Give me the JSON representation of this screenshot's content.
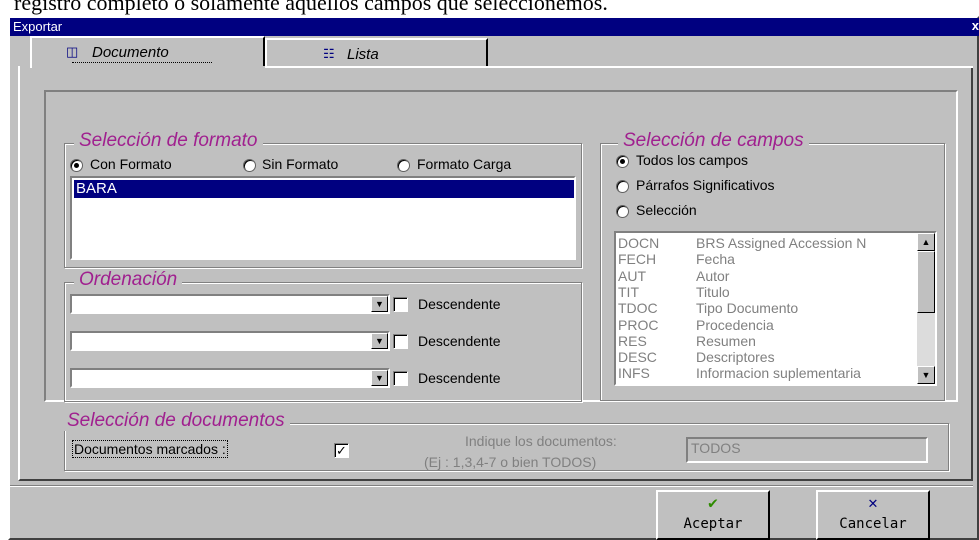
{
  "page_text": "registro completo o solamente aquellos campos que seleccionemos.",
  "window": {
    "title": "Exportar",
    "close_glyph": "x"
  },
  "tabs": [
    {
      "label": "Documento",
      "icon": "document-icon"
    },
    {
      "label": "Lista",
      "icon": "list-icon"
    }
  ],
  "formato": {
    "legend": "Selección de formato",
    "options": [
      "Con Formato",
      "Sin Formato",
      "Formato Carga"
    ],
    "selected": "Con Formato",
    "list_items": [
      "BARA"
    ]
  },
  "ordenacion": {
    "legend": "Ordenación",
    "rows": [
      {
        "value": "",
        "checkbox_label": "Descendente",
        "checked": false
      },
      {
        "value": "",
        "checkbox_label": "Descendente",
        "checked": false
      },
      {
        "value": "",
        "checkbox_label": "Descendente",
        "checked": false
      }
    ]
  },
  "campos": {
    "legend": "Selección de campos",
    "options": [
      "Todos los campos",
      "Párrafos Significativos",
      "Selección"
    ],
    "selected": "Todos los campos",
    "fields": [
      {
        "code": "DOCN",
        "desc": "BRS Assigned Accession N"
      },
      {
        "code": "FECH",
        "desc": "Fecha"
      },
      {
        "code": "AUT",
        "desc": "Autor"
      },
      {
        "code": "TIT",
        "desc": "Titulo"
      },
      {
        "code": "TDOC",
        "desc": "Tipo Documento"
      },
      {
        "code": "PROC",
        "desc": "Procedencia"
      },
      {
        "code": "RES",
        "desc": "Resumen"
      },
      {
        "code": "DESC",
        "desc": "Descriptores"
      },
      {
        "code": "INFS",
        "desc": "Informacion suplementaria"
      }
    ]
  },
  "documentos": {
    "legend": "Selección de documentos",
    "marcados_label": "Documentos marcados :",
    "marcados_checked": true,
    "hint_line1": "Indique los documentos:",
    "hint_line2": "(Ej : 1,3,4-7 o bien TODOS)",
    "input_value": "TODOS"
  },
  "buttons": {
    "accept_label": "Aceptar",
    "cancel_label": "Cancelar"
  },
  "colors": {
    "titlebar": "#000080",
    "legend": "#a0208f",
    "face": "#c0c0c0",
    "accept_icon": "#2e8b00",
    "cancel_icon": "#000080"
  }
}
